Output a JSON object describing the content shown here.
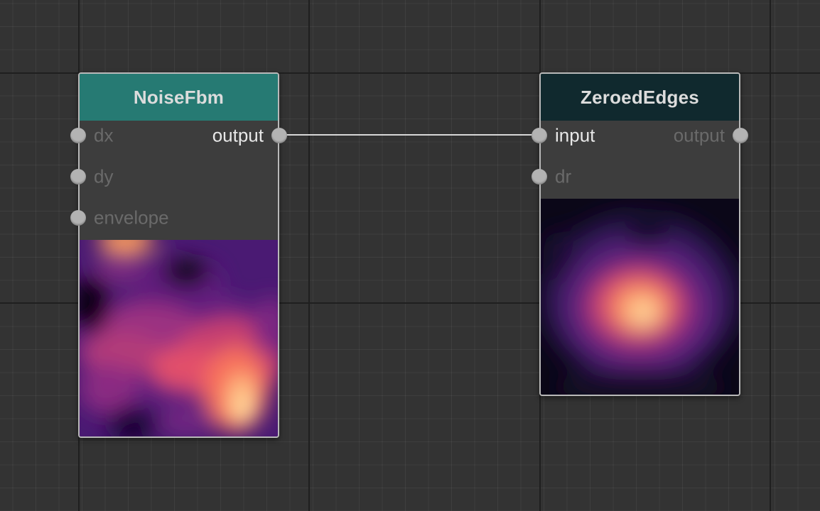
{
  "canvas": {
    "background": "#333333",
    "grid_color_major": "#1f1f1f"
  },
  "nodes": [
    {
      "id": "noisefbm",
      "title": "NoiseFbm",
      "header_color": "#267a73",
      "inputs": [
        {
          "label": "dx",
          "connected": false
        },
        {
          "label": "dy",
          "connected": false
        },
        {
          "label": "envelope",
          "connected": false
        }
      ],
      "outputs": [
        {
          "label": "output",
          "connected": true
        }
      ],
      "preview": "magma-colormap noise preview"
    },
    {
      "id": "zeroededges",
      "title": "ZeroedEdges",
      "header_color": "#10292e",
      "inputs": [
        {
          "label": "input",
          "connected": true
        },
        {
          "label": "dr",
          "connected": false
        }
      ],
      "outputs": [
        {
          "label": "output",
          "connected": false
        }
      ],
      "preview": "magma-colormap centered blob preview"
    }
  ],
  "connections": [
    {
      "from": "NoiseFbm.output",
      "to": "ZeroedEdges.input"
    }
  ]
}
